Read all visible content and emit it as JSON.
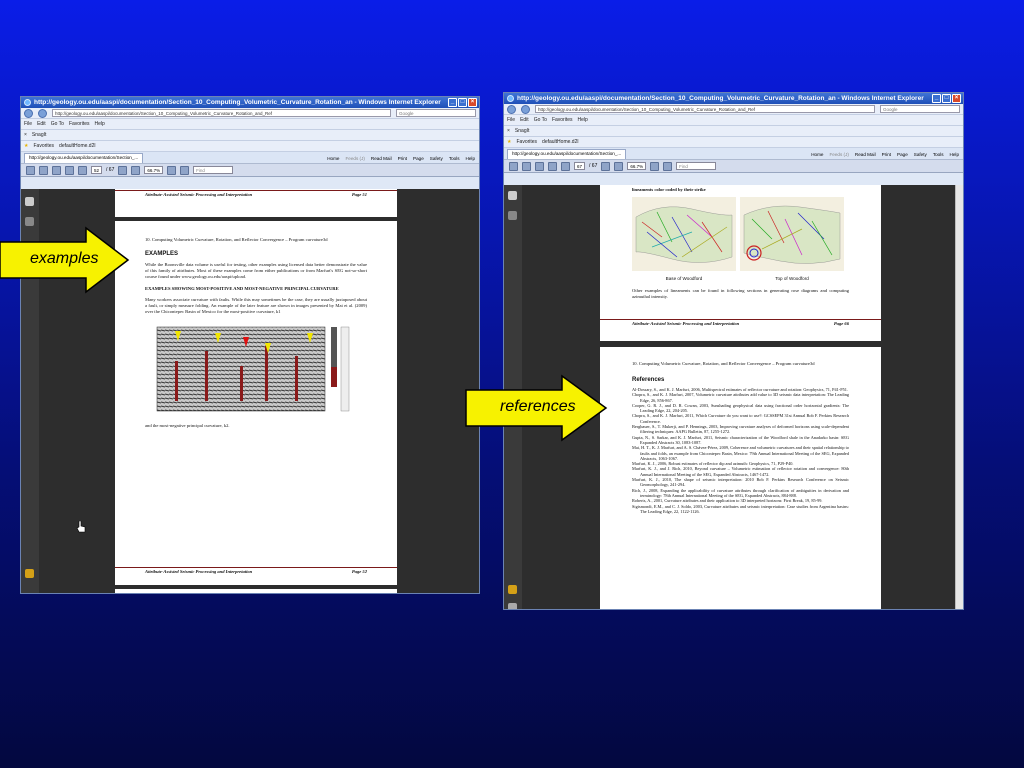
{
  "browser": {
    "title": "http://geology.ou.edu/aaspi/documentation/Section_10_Computing_Volumetric_Curvature_Rotation_an - Windows Internet Explorer",
    "address": "http://geology.ou.edu/aaspi/documentation/Section_10_Computing_Volumetric_Curvature_Rotation_and_Ref",
    "search_placeholder": "Google",
    "menu": [
      "File",
      "Edit",
      "Go To",
      "Favorites",
      "Help"
    ],
    "snagit": "SnagIt",
    "favorites": "Favorites",
    "fav_link": "defaultHome.d2l",
    "tab_left": "http://geology.ou.edu/aaspi/documentation/Section_...",
    "tab_right": "http://geology.ou.edu/aaspi/documentation/Section_...",
    "tools": [
      "Home",
      "Feeds (J)",
      "Read Mail",
      "Print",
      "Page",
      "Safety",
      "Tools",
      "Help"
    ],
    "zoom": "66.7%",
    "find": "Find"
  },
  "left_window": {
    "page_num": "52",
    "page_total": "/ 67",
    "top_footer_left": "Attribute-Assisted Seismic Processing and Interpretation",
    "top_footer_right": "Page 51",
    "section_heading": "10. Computing Volumetric Curvature, Rotation, and Reflector Convergence – Program curvature3d",
    "examples_heading": "EXAMPLES",
    "para1": "While the Boonsville data volume is useful for testing, other examples using licensed data better demonstrate the value of this family of attributes. Most of these examples come from either publications or from Marfurt's SEG not-so-short course found under www.geology.ou.edu/aaspi/upload.",
    "subheading": "EXAMPLES SHOWING MOST-POSITIVE AND MOST-NEGATIVE PRINCIPAL CURVATURE",
    "para2": "Many workers associate curvature with faults. While this may sometimes be the case, they are usually juxtaposed about a fault, or simply measure folding. An example of the later feature are shown in images presented by Mai et al. (2009) over the Chicontepec Basin of Mexico for the most-positive curvature, k1",
    "caption": "and the most-negative principal curvature, k2.",
    "bottom_footer_left": "Attribute-Assisted Seismic Processing and Interpretation",
    "bottom_footer_right": "Page 52"
  },
  "right_window": {
    "page_num": "67",
    "page_total": "/ 67",
    "top_text": "lineaments color coded by their strike",
    "map_left_label": "Base of Woodford",
    "map_right_label": "Top of Woodford",
    "para": "Other examples of lineaments can be found in following sections in generating rose diagrams and computing azimuthal intensity.",
    "footer_left": "Attribute-Assisted Seismic Processing and Interpretation",
    "footer_right": "Page 66",
    "section_heading": "10. Computing Volumetric Curvature, Rotation, and Reflector Convergence – Program curvature3d",
    "references_heading": "References",
    "references": [
      "Al-Dossary, S., and K. J. Marfurt, 2006, Multispectral estimates of reflector curvature and rotation: Geophysics, 71, P41-P51.",
      "Chopra, S., and K. J. Marfurt, 2007, Volumetric curvature attributes add value to 3D seismic data interpretation: The Leading Edge, 26, 856-867.",
      "Cooper, G. R. J., and D. R. Cowan, 2003, Sunshading geophysical data using fractional order horizontal gradients: The Leading Edge, 22, 204-205.",
      "Chopra, S., and K. J. Marfurt, 2011, Which Curvature do you want to use?: GCSSEPM 31st Annual Bob F. Perkins Research Conference.",
      "Bergbauer, S., T. Mukerji, and P. Hennings, 2003, Improving curvature analyses of deformed horizons using scale-dependent filtering techniques: AAPG Bulletin, 87, 1255-1272.",
      "Gupta, N., S. Sarkar, and K. J. Marfurt, 2011, Seismic characterization of the Woodford shale in the Anadarko basin: SEG Expanded Abstracts 30, 1083-1087.",
      "Mai, H. T., K. J. Marfurt, and A. S. Chávez-Pérez, 2009, Coherence and volumetric curvatures and their spatial relationship to faults and folds, an example from Chicontepec Basin, Mexico: 79th Annual International Meeting of the SEG, Expanded Abstracts, 1063-1067.",
      "Marfurt, K. J., 2006, Robust estimates of reflector dip and azimuth: Geophysics, 71, P29-P40.",
      "Marfurt, K. J., and J. Rich, 2010, Beyond curvature – Volumetric estimation of reflector rotation and convergence: 80th Annual International Meeting of the SEG, Expanded Abstracts, 1467-1472.",
      "Marfurt, K. J., 2010, The shape of seismic interpretation: 2010 Bob F. Perkins Research Conference on Seismic Geomorphology, 241-294.",
      "Rich, J., 2008, Expanding the applicability of curvature attributes through clarification of ambiguities in derivation and terminology: 78th Annual International Meeting of the SEG, Expanded Abstracts, 884-888.",
      "Roberts, A., 2001, Curvature attributes and their application to 3D interpreted horizons: First Break, 19, 85-99.",
      "Sigismondi, E.M., and C. J. Soldo, 2003, Curvature attributes and seismic interpretation: Case studies from Argentina basins: The Leading Edge, 22, 1122-1126."
    ]
  },
  "callouts": {
    "examples": "examples",
    "references": "references"
  }
}
